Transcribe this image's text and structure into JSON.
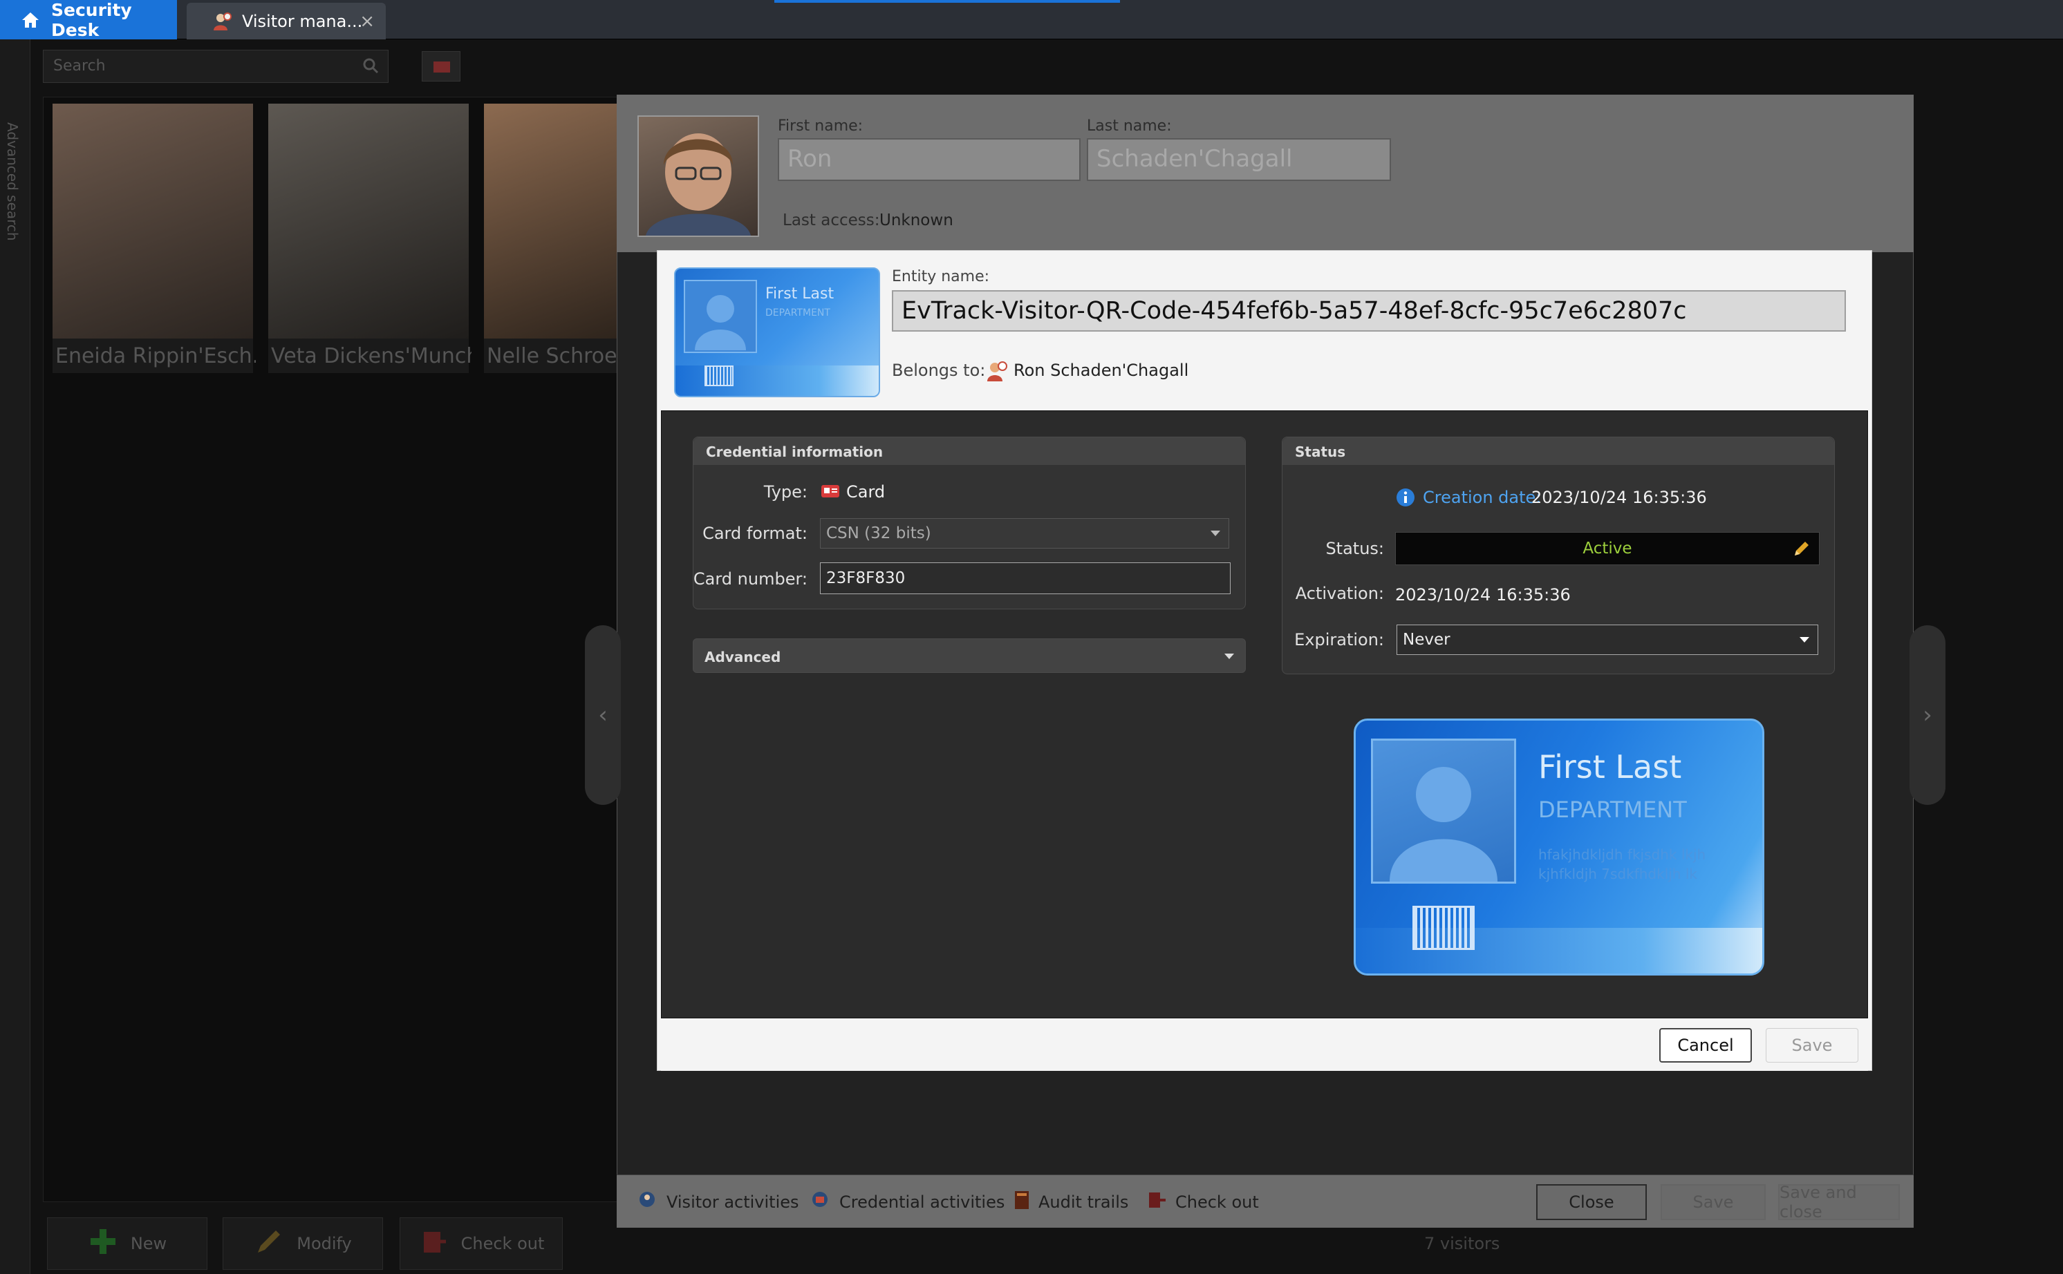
{
  "tabs": {
    "home": "Security Desk",
    "visitor": "Visitor mana..."
  },
  "background": {
    "search_placeholder": "Search",
    "sidebar_text": "Advanced search",
    "visitors": [
      "Eneida Rippin'Esch...",
      "Veta Dickens'Munch",
      "Nelle Schroed"
    ],
    "buttons": {
      "new": "New",
      "modify": "Modify",
      "checkout": "Check out"
    },
    "count": "7 visitors"
  },
  "visitor_window": {
    "first_name_label": "First name:",
    "first_name": "Ron",
    "last_name_label": "Last name:",
    "last_name": "Schaden'Chagall",
    "last_access_label": "Last access:",
    "last_access": "Unknown",
    "footer": {
      "visitor_activities": "Visitor activities",
      "credential_activities": "Credential activities",
      "audit_trails": "Audit trails",
      "check_out": "Check out",
      "close": "Close",
      "save": "Save",
      "save_and_close": "Save and close"
    }
  },
  "dialog": {
    "thumb_name": "First Last",
    "thumb_dept": "DEPARTMENT",
    "entity_label": "Entity name:",
    "entity_name": "EvTrack-Visitor-QR-Code-454fef6b-5a57-48ef-8cfc-95c7e6c2807c",
    "belongs_label": "Belongs to:",
    "belongs_value": "Ron Schaden'Chagall",
    "credential": {
      "header": "Credential information",
      "type_label": "Type:",
      "type_value": "Card",
      "format_label": "Card format:",
      "format_value": "CSN (32 bits)",
      "number_label": "Card number:",
      "number_value": "23F8F830"
    },
    "advanced": "Advanced",
    "status": {
      "header": "Status",
      "creation_label": "Creation date:",
      "creation_value": "2023/10/24 16:35:36",
      "status_label": "Status:",
      "status_value": "Active",
      "activation_label": "Activation:",
      "activation_value": "2023/10/24 16:35:36",
      "expiration_label": "Expiration:",
      "expiration_value": "Never"
    },
    "card": {
      "name": "First Last",
      "dept": "DEPARTMENT",
      "line1": "hfakjhdkljdh fkjsdhk lkjh",
      "line2": "kjhfkldjh 7sdkfhdkljh lk"
    },
    "cancel": "Cancel",
    "save": "Save"
  },
  "colors": {
    "accent": "#1a73d9",
    "status_active": "#9ccf3c"
  }
}
